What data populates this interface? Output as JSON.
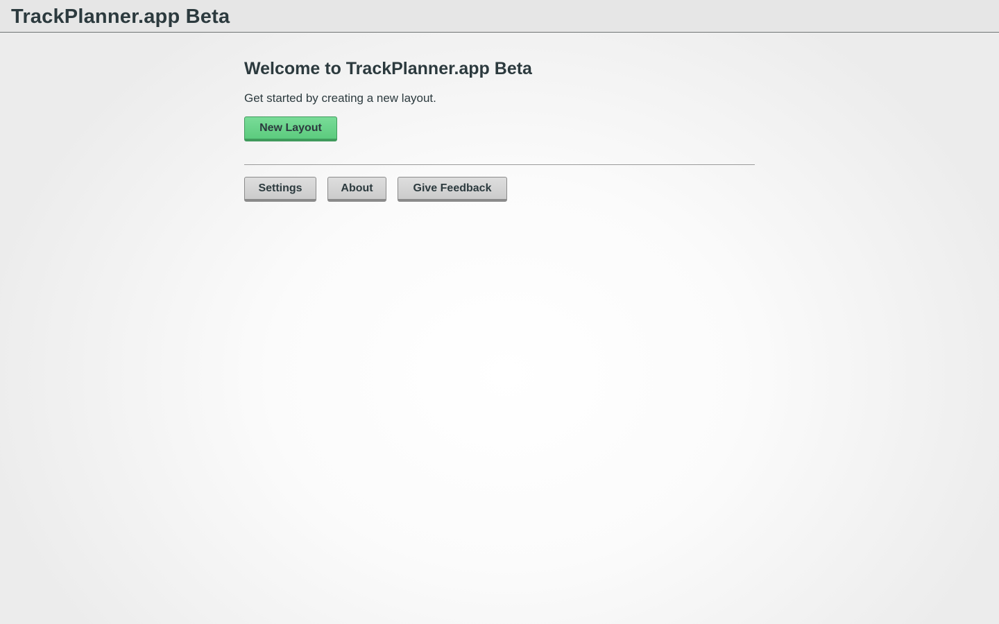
{
  "header": {
    "app_title": "TrackPlanner.app Beta"
  },
  "main": {
    "welcome_title": "Welcome to TrackPlanner.app Beta",
    "intro_text": "Get started by creating a new layout.",
    "new_layout_label": "New Layout",
    "settings_label": "Settings",
    "about_label": "About",
    "feedback_label": "Give Feedback"
  },
  "colors": {
    "primary_button": "#5ccb7e",
    "secondary_button": "#d4d4d4",
    "text": "#2c3a3e",
    "header_bg": "#e6e6e6"
  }
}
